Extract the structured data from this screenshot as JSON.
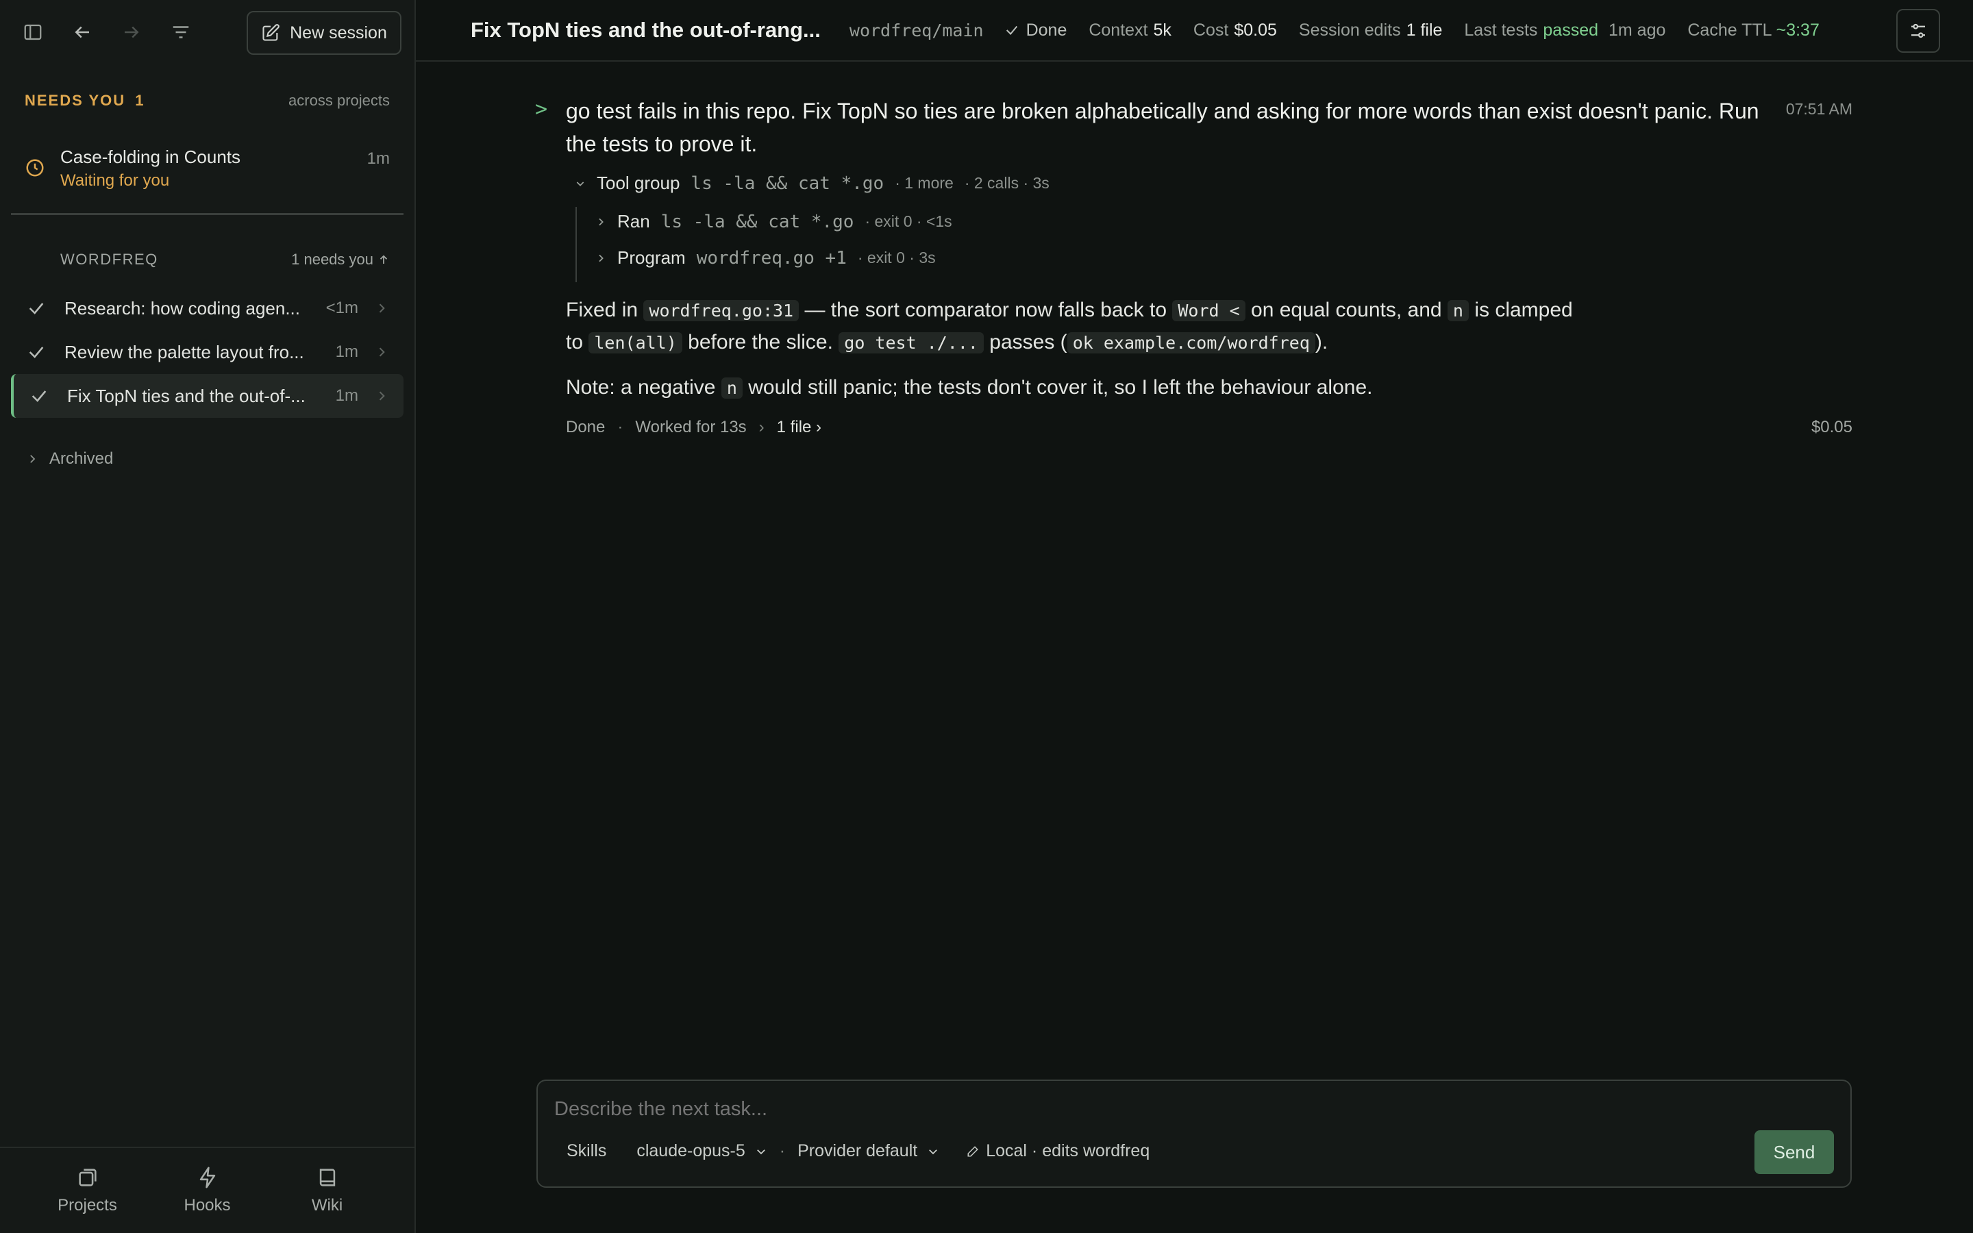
{
  "sidebar": {
    "new_session_label": "New session",
    "needs_you": {
      "title": "NEEDS YOU",
      "count": "1",
      "scope": "across projects"
    },
    "waiting_item": {
      "title": "Case-folding in Counts",
      "status": "Waiting for you",
      "age": "1m"
    },
    "project": {
      "name": "WORDFREQ",
      "summary": "1 needs you"
    },
    "sessions": [
      {
        "title": "Research: how coding agen...",
        "age": "<1m"
      },
      {
        "title": "Review the palette layout fro...",
        "age": "1m"
      },
      {
        "title": "Fix TopN ties and the out-of-...",
        "age": "1m",
        "active": true
      }
    ],
    "archived_label": "Archived",
    "bottom_nav": [
      {
        "label": "Projects",
        "icon": "projects-icon"
      },
      {
        "label": "Hooks",
        "icon": "lightning-icon"
      },
      {
        "label": "Wiki",
        "icon": "book-icon"
      }
    ]
  },
  "header": {
    "title": "Fix TopN ties and the out-of-rang...",
    "branch": "wordfreq/main",
    "status": "Done",
    "context_label": "Context",
    "context_value": "5k",
    "cost_label": "Cost",
    "cost_value": "$0.05",
    "edits_label": "Session edits",
    "edits_value": "1 file",
    "tests_label": "Last tests",
    "tests_value": "passed",
    "tests_age": "1m ago",
    "cache_label": "Cache TTL",
    "cache_value": "~3:37"
  },
  "conversation": {
    "prompt_marker": ">",
    "prompt": "go test fails in this repo. Fix TopN so ties are broken alphabetically and asking for more words than exist doesn't panic. Run the tests to prove it.",
    "prompt_time": "07:51 AM",
    "tool_group": {
      "label": "Tool group",
      "command": "ls -la && cat *.go",
      "more": "· 1 more",
      "meta": "· 2 calls · 3s"
    },
    "tool_lines": [
      {
        "label": "Ran",
        "command": "ls -la && cat *.go",
        "meta": "· exit 0 · <1s"
      },
      {
        "label": "Program",
        "command": "wordfreq.go +1",
        "meta": "· exit 0 · 3s"
      }
    ],
    "reply1": {
      "a": "Fixed in",
      "code1": "wordfreq.go:31",
      "b": "— the sort comparator now falls back to",
      "code2": "Word <",
      "c": "on equal counts, and",
      "code3": "n",
      "d": "is clamped to",
      "code4": "len(all)",
      "e": "before the slice.",
      "code5": "go test ./...",
      "f": "passes (",
      "code6": "ok example.com/wordfreq",
      "g": ")."
    },
    "reply2": {
      "a": "Note: a negative",
      "code1": "n",
      "b": "would still panic; the tests don't cover it, so I left the behaviour alone."
    },
    "footer": {
      "status": "Done",
      "worked": "Worked for 13s",
      "files": "1 file ›",
      "cost": "$0.05"
    }
  },
  "composer": {
    "placeholder": "Describe the next task...",
    "skills": "Skills",
    "model": "claude-opus-5",
    "provider": "Provider default",
    "mode": "Local · edits wordfreq",
    "send": "Send"
  },
  "colors": {
    "accent_green": "#6fbf86",
    "warning_amber": "#e0a84f",
    "send_bg": "#3f6b4c"
  }
}
